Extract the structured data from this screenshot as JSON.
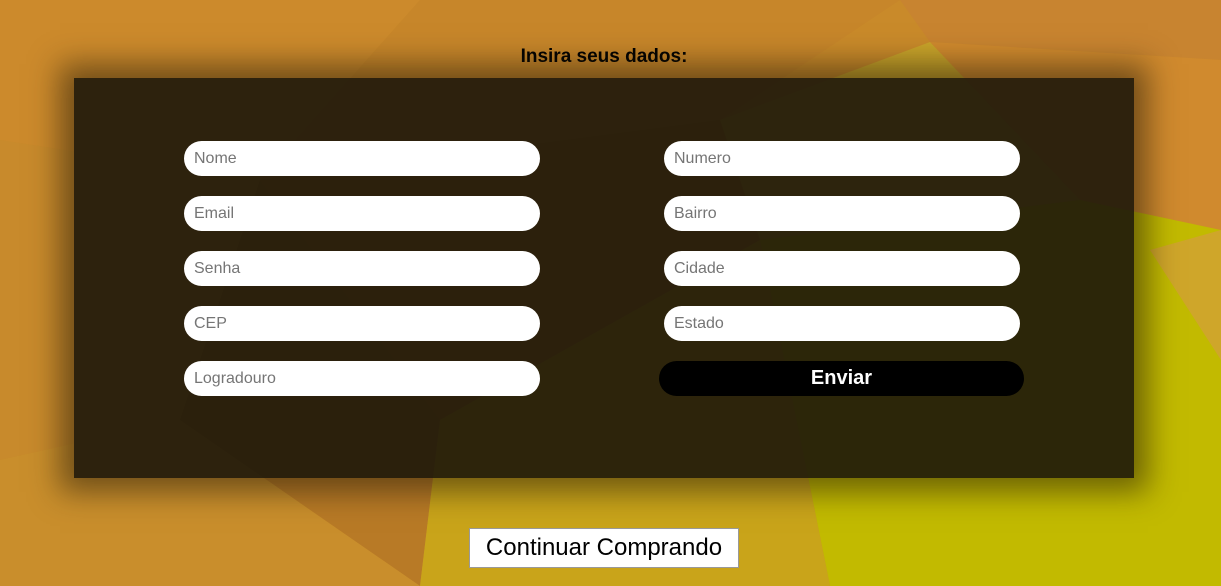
{
  "page": {
    "heading": "Insira seus dados:"
  },
  "form": {
    "left_fields": [
      {
        "placeholder": "Nome",
        "value": ""
      },
      {
        "placeholder": "Email",
        "value": ""
      },
      {
        "placeholder": "Senha",
        "value": ""
      },
      {
        "placeholder": "CEP",
        "value": ""
      },
      {
        "placeholder": "Logradouro",
        "value": ""
      }
    ],
    "right_fields": [
      {
        "placeholder": "Numero",
        "value": ""
      },
      {
        "placeholder": "Bairro",
        "value": ""
      },
      {
        "placeholder": "Cidade",
        "value": ""
      },
      {
        "placeholder": "Estado",
        "value": ""
      }
    ],
    "submit_label": "Enviar"
  },
  "footer": {
    "continue_label": "Continuar Comprando"
  },
  "colors": {
    "background_orange": "#c98a2a",
    "background_yellow": "#c2ba00",
    "panel": "#1c160a",
    "submit_button": "#000000",
    "field_background": "#ffffff"
  }
}
